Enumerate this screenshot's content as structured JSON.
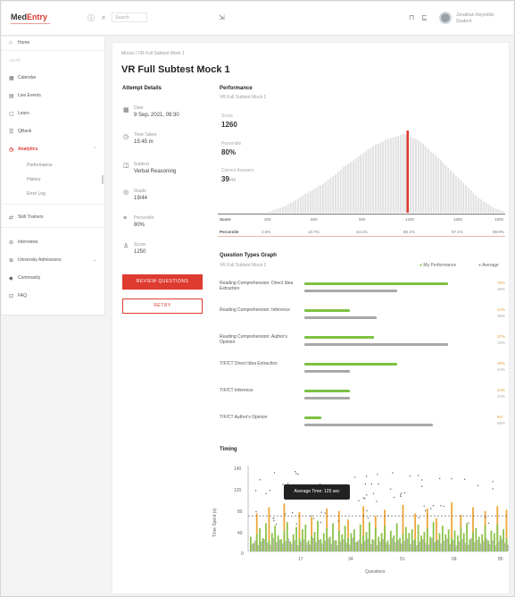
{
  "app": {
    "logo_main": "Med",
    "logo_accent": "Entry",
    "search_placeholder": "Search",
    "user_name": "Jonathan Reynolds",
    "user_sub": "Student"
  },
  "sidebar": {
    "items": [
      {
        "icon": "⌂",
        "label": "Home",
        "name": "home"
      },
      {
        "section": "UCAT"
      },
      {
        "icon": "▦",
        "label": "Calendar",
        "name": "calendar"
      },
      {
        "icon": "▤",
        "label": "Live Events",
        "name": "live-events"
      },
      {
        "icon": "▢",
        "label": "Learn",
        "name": "learn"
      },
      {
        "icon": "☰",
        "label": "QBank",
        "name": "qbank"
      },
      {
        "icon": "◷",
        "label": "Analytics",
        "name": "analytics",
        "active": true
      },
      {
        "icon": "⇄",
        "label": "Skill Trainers",
        "name": "skill-trainers"
      },
      {
        "icon": "⊘",
        "label": "Interviews",
        "name": "interviews"
      },
      {
        "icon": "⊕",
        "label": "University Admissions",
        "name": "university-admissions"
      },
      {
        "icon": "◆",
        "label": "Community",
        "name": "community"
      },
      {
        "icon": "⊡",
        "label": "FAQ",
        "name": "faq"
      }
    ],
    "sub_items": [
      "Performance",
      "History",
      "Error Log"
    ]
  },
  "page": {
    "breadcrumb": "Mocks / VR Full Subtest Mock 1",
    "title": "VR Full Subtest Mock 1"
  },
  "attempt": {
    "heading": "Attempt Details",
    "fields": [
      {
        "icon": "▦",
        "label": "Date",
        "value": "9 Sep, 2021, 09:30"
      },
      {
        "icon": "◷",
        "label": "Time Taken",
        "value": "15:45 m"
      },
      {
        "icon": "◫",
        "label": "Subtest",
        "value": "Verbal Reasoning"
      },
      {
        "icon": "◎",
        "label": "Grade",
        "value": "19/44"
      },
      {
        "icon": "≡",
        "label": "Percentile",
        "value": "80%"
      },
      {
        "icon": "♙",
        "label": "Score",
        "value": "1250"
      }
    ],
    "review_button": "REVIEW QUESTIONS",
    "retry_button": "RETRY"
  },
  "performance": {
    "heading": "Performance",
    "subtitle": "VR Full Subtest Mock 1",
    "score_label": "Score",
    "score_value": "1260",
    "percentile_label": "Percentile",
    "percentile_value": "80%",
    "correct_label": "Correct Answers",
    "correct_value": "39",
    "correct_total": "/44",
    "row_score": "Score",
    "row_percentile": "Percentile",
    "score_ticks": [
      "300",
      "600",
      "900",
      "1250",
      "1800",
      "1900"
    ],
    "percentile_ticks": [
      "2.5%",
      "13.7%",
      "44.1%",
      "80.1%",
      "97.1%",
      "99.9%"
    ]
  },
  "question_types": {
    "heading": "Question Types Graph",
    "subtitle": "VR Full Subtest Mock 1",
    "legend_mine": "My Performance",
    "legend_avg": "Average",
    "rows": [
      {
        "label": "Reading Comprehension: Direct Idea Extraction",
        "mine": 0.76,
        "avg": 0.49,
        "mine_label": "76%",
        "avg_label": "49%"
      },
      {
        "label": "Reading Comprehension: Inference",
        "mine": 0.24,
        "avg": 0.38,
        "mine_label": "24%",
        "avg_label": "38%"
      },
      {
        "label": "Reading Comprehension: Author's Opinion",
        "mine": 0.37,
        "avg": 0.76,
        "mine_label": "37%",
        "avg_label": "76%"
      },
      {
        "label": "T/F/CT Direct Idea Extraction",
        "mine": 0.49,
        "avg": 0.24,
        "mine_label": "49%",
        "avg_label": "24%"
      },
      {
        "label": "T/F/CT Inference",
        "mine": 0.24,
        "avg": 0.24,
        "mine_label": "24%",
        "avg_label": "24%"
      },
      {
        "label": "T/F/CT Author's Opinion",
        "mine": 0.09,
        "avg": 0.68,
        "mine_label": "9%",
        "avg_label": "68%"
      }
    ]
  },
  "timing": {
    "heading": "Timing",
    "ylabel": "Time Spent (s)",
    "xlabel": "Questions",
    "tooltip": "Average Time: 125 sec",
    "y_ticks": [
      "140",
      "120",
      "80",
      "40",
      "0"
    ],
    "x_ticks": [
      "17",
      "34",
      "51",
      "68",
      "85"
    ]
  },
  "chart_data": [
    {
      "type": "bar",
      "title": "Performance",
      "xlabel": "Score",
      "x_range": [
        300,
        1900
      ],
      "highlight_x": 1250,
      "distribution": [
        2,
        3,
        4,
        5,
        6,
        7,
        8,
        10,
        12,
        13,
        15,
        17,
        19,
        21,
        23,
        24,
        26,
        28,
        30,
        32,
        33,
        35,
        37,
        40,
        42,
        44,
        46,
        49,
        52,
        55,
        57,
        59,
        61,
        63,
        65,
        68,
        70,
        72,
        74,
        77,
        78,
        80,
        82,
        83,
        85,
        86,
        88,
        89,
        90,
        91,
        92,
        93,
        94,
        95,
        94,
        93,
        92,
        90,
        89,
        87,
        85,
        83,
        80,
        77,
        74,
        72,
        69,
        66,
        63,
        60,
        57,
        54,
        51,
        48,
        45,
        42,
        39,
        36,
        33,
        30,
        27,
        24,
        21,
        18,
        16,
        14,
        12,
        10,
        8,
        6,
        5,
        4,
        3,
        2
      ]
    },
    {
      "type": "bar",
      "title": "Question Types Graph",
      "categories": [
        "Reading Comprehension: Direct Idea Extraction",
        "Reading Comprehension: Inference",
        "Reading Comprehension: Author's Opinion",
        "T/F/CT Direct Idea Extraction",
        "T/F/CT Inference",
        "T/F/CT Author's Opinion"
      ],
      "series": [
        {
          "name": "My Performance",
          "values": [
            76,
            24,
            37,
            49,
            24,
            9
          ]
        },
        {
          "name": "Average",
          "values": [
            49,
            38,
            76,
            24,
            24,
            68
          ]
        }
      ],
      "ylim": [
        0,
        100
      ]
    },
    {
      "type": "bar",
      "title": "Timing",
      "xlabel": "Questions",
      "ylabel": "Time Spent (s)",
      "ylim": [
        0,
        140
      ],
      "average_line": 58,
      "series": [
        {
          "name": "Green",
          "values": [
            24,
            14,
            28,
            38,
            22,
            46,
            18,
            30,
            42,
            26,
            20,
            34,
            48,
            16,
            28,
            40,
            22,
            36,
            44,
            18,
            26,
            32,
            50,
            20,
            30,
            38,
            24,
            46,
            18,
            34,
            28,
            42,
            22,
            30,
            36,
            16,
            44,
            26,
            32,
            48,
            20,
            38,
            24,
            30,
            42,
            18,
            34,
            26,
            46,
            22,
            28,
            40,
            30,
            36,
            20,
            44,
            26,
            32,
            38,
            24,
            48,
            18,
            30,
            42,
            28,
            36,
            22,
            34,
            26,
            40,
            30,
            46,
            20,
            32,
            38,
            24,
            28,
            42,
            18,
            34,
            30,
            44,
            26,
            36,
            22
          ]
        },
        {
          "name": "Orange",
          "values": [
            0,
            0,
            62,
            0,
            0,
            0,
            72,
            0,
            0,
            0,
            0,
            78,
            0,
            0,
            0,
            0,
            64,
            0,
            0,
            0,
            56,
            0,
            0,
            0,
            0,
            70,
            0,
            0,
            0,
            66,
            0,
            0,
            52,
            0,
            0,
            0,
            0,
            74,
            0,
            0,
            0,
            58,
            0,
            0,
            68,
            0,
            0,
            0,
            0,
            0,
            76,
            0,
            0,
            0,
            62,
            0,
            0,
            0,
            70,
            0,
            0,
            54,
            0,
            0,
            0,
            0,
            80,
            0,
            0,
            60,
            0,
            0,
            0,
            72,
            0,
            0,
            0,
            66,
            0,
            0,
            0,
            74,
            0,
            0,
            68
          ]
        },
        {
          "name": "Gray",
          "values": [
            12,
            18,
            10,
            16,
            20,
            14,
            11,
            22,
            15,
            19,
            13,
            17,
            21,
            12,
            18,
            10,
            16,
            20,
            14,
            11,
            22,
            15,
            19,
            13,
            17,
            21,
            12,
            18,
            10,
            16,
            20,
            14,
            11,
            22,
            15,
            19,
            13,
            17,
            21,
            12,
            18,
            10,
            16,
            20,
            14,
            11,
            22,
            15,
            19,
            13,
            17,
            21,
            12,
            18,
            10,
            16,
            20,
            14,
            11,
            22,
            15,
            19,
            13,
            17,
            21,
            12,
            18,
            10,
            16,
            20,
            14,
            11,
            22,
            15,
            19,
            13,
            17,
            21,
            12,
            18,
            10,
            16,
            20,
            14,
            11
          ]
        }
      ],
      "scatter_points": 75
    }
  ]
}
